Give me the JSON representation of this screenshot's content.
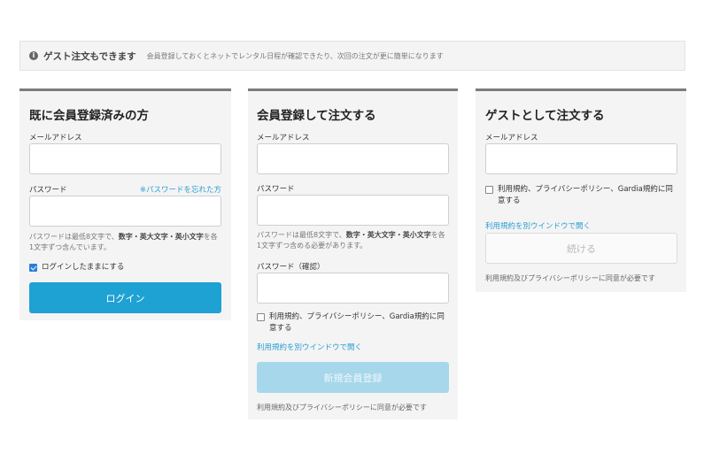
{
  "notice": {
    "icon": "info-icon",
    "title": "ゲスト注文もできます",
    "text": "会員登録しておくとネットでレンタル日程が確認できたり、次回の注文が更に簡単になります"
  },
  "login": {
    "title": "既に会員登録済みの方",
    "email_label": "メールアドレス",
    "email_value": "",
    "password_label": "パスワード",
    "password_value": "",
    "forgot_link": "※パスワードを忘れた方",
    "password_hint_prefix": "パスワードは最低8文字で、",
    "password_hint_bold": "数字・英大文字・英小文字",
    "password_hint_suffix": "を各1文字ずつ含んでいます。",
    "remember_label": "ログインしたままにする",
    "remember_checked": true,
    "login_button": "ログイン"
  },
  "register": {
    "title": "会員登録して注文する",
    "email_label": "メールアドレス",
    "email_value": "",
    "password_label": "パスワード",
    "password_value": "",
    "password_hint_prefix": "パスワードは最低8文字で、",
    "password_hint_bold": "数字・英大文字・英小文字",
    "password_hint_suffix": "を各1文字ずつ含める必要があります。",
    "confirm_label": "パスワード（確認）",
    "confirm_value": "",
    "terms_label": "利用規約、プライバシーポリシー、Gardia規約に同意する",
    "terms_checked": false,
    "terms_link": "利用規約を別ウインドウで開く",
    "submit_button": "新規会員登録",
    "consent_note": "利用規約及びプライバシーポリシーに同意が必要です"
  },
  "guest": {
    "title": "ゲストとして注文する",
    "email_label": "メールアドレス",
    "email_value": "",
    "terms_label": "利用規約、プライバシーポリシー、Gardia規約に同意する",
    "terms_checked": false,
    "terms_link": "利用規約を別ウインドウで開く",
    "continue_button": "続ける",
    "consent_note": "利用規約及びプライバシーポリシーに同意が必要です"
  }
}
